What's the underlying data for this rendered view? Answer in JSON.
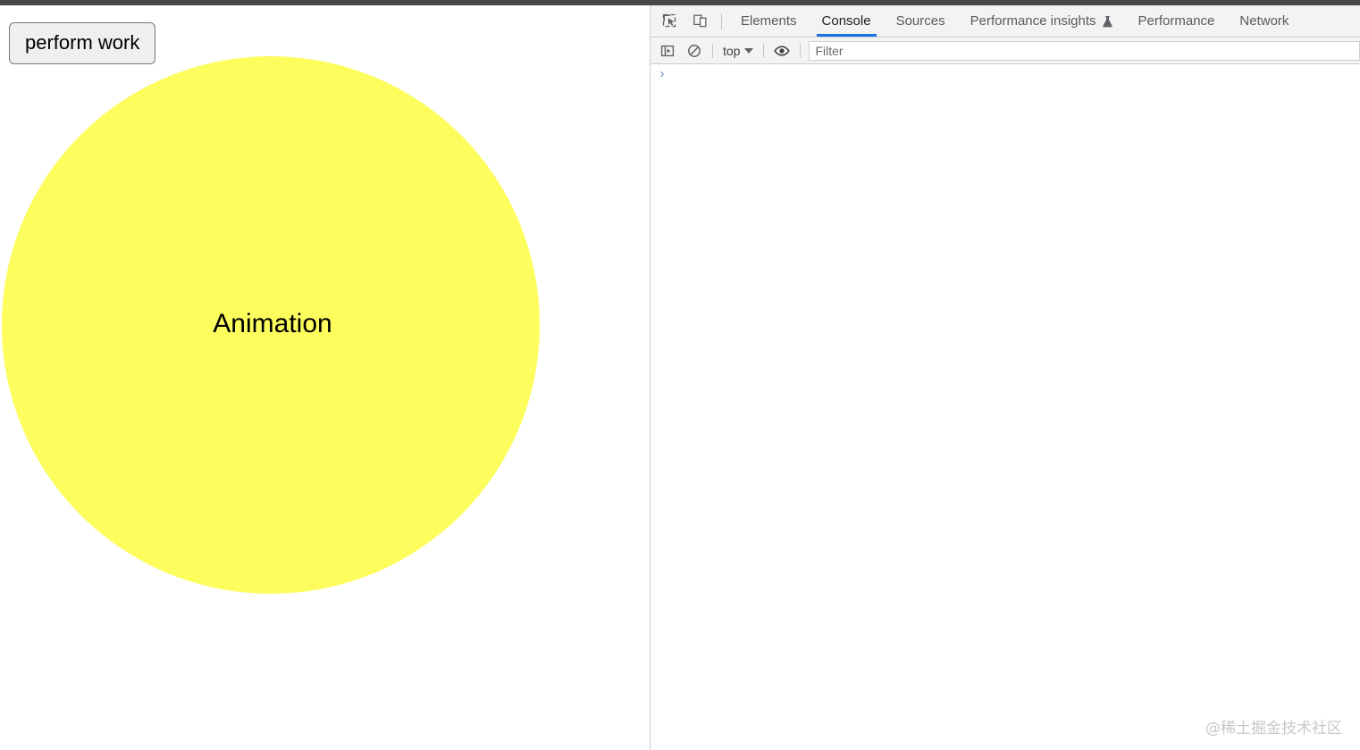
{
  "page": {
    "perform_work_button": "perform work",
    "circle_label": "Animation",
    "circle_color": "#fdfd5e"
  },
  "devtools": {
    "toolbar_icons": [
      {
        "name": "inspect-element-icon",
        "title": "Inspect element"
      },
      {
        "name": "device-toolbar-icon",
        "title": "Toggle device toolbar"
      }
    ],
    "tabs": [
      {
        "label": "Elements",
        "active": false,
        "icon": ""
      },
      {
        "label": "Console",
        "active": true,
        "icon": ""
      },
      {
        "label": "Sources",
        "active": false,
        "icon": ""
      },
      {
        "label": "Performance insights",
        "active": false,
        "icon": "flask-icon"
      },
      {
        "label": "Performance",
        "active": false,
        "icon": ""
      },
      {
        "label": "Network",
        "active": false,
        "icon": ""
      }
    ],
    "active_tab_accent": "#1a73e8",
    "console": {
      "sidebar_toggle_icon": "console-sidebar-icon",
      "clear_console_icon": "clear-console-icon",
      "context_selector": "top",
      "eye_icon": "live-expression-eye-icon",
      "filter_placeholder": "Filter",
      "filter_value": "",
      "prompt_chevron": "›",
      "prompt_value": ""
    }
  },
  "watermark": {
    "text": "@稀土掘金技术社区"
  }
}
